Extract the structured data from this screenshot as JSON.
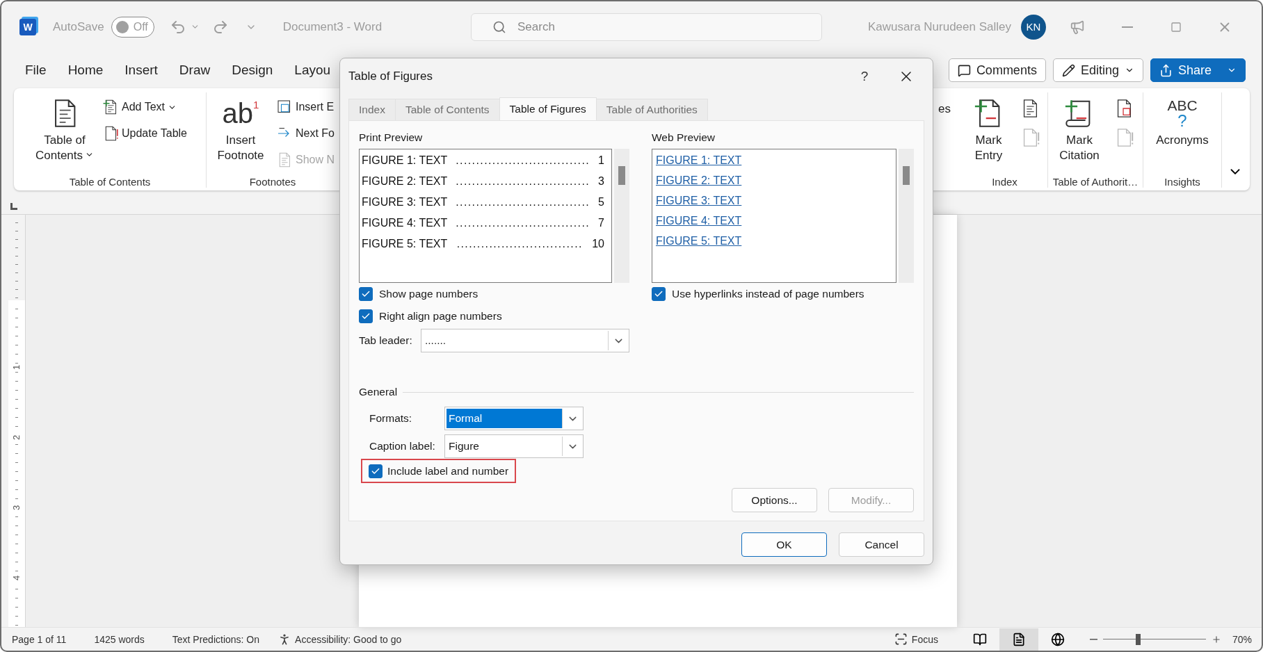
{
  "window": {
    "app_icon": "W",
    "autosave": {
      "label": "AutoSave",
      "on": false,
      "state": "Off"
    },
    "document_title": "Document3 - Word",
    "search": {
      "placeholder": "Search"
    },
    "user": {
      "name": "Kawusara Nurudeen Salley",
      "initials": "KN"
    }
  },
  "menu": {
    "tabs": [
      "File",
      "Home",
      "Insert",
      "Draw",
      "Design",
      "Layou"
    ],
    "actions": [
      {
        "kind": "comments",
        "label": "Comments"
      },
      {
        "kind": "editing",
        "label": "Editing"
      },
      {
        "kind": "share",
        "label": "Share"
      }
    ]
  },
  "ribbon": {
    "left_groups": [
      {
        "label": "Table of Contents",
        "items": [
          {
            "kind": "toc",
            "label": "Table of Contents",
            "dropdown": true
          },
          {
            "kind": "add-text",
            "label": "Add Text",
            "dropdown": true
          },
          {
            "kind": "update-table",
            "label": "Update Table",
            "dropdown": false
          }
        ]
      },
      {
        "label": "Footnotes",
        "items": [
          {
            "kind": "footnote",
            "label": "Insert Footnote",
            "glyph": "ab",
            "mark": "1"
          },
          {
            "kind": "insert-endnote",
            "label": "Insert E",
            "disabled": false
          },
          {
            "kind": "next-footnote",
            "label": "Next Fo",
            "disabled": false
          },
          {
            "kind": "show-notes",
            "label": "Show N",
            "disabled": true
          }
        ]
      }
    ],
    "fragment": "es",
    "right_groups": [
      {
        "label": "Index",
        "items": [
          {
            "kind": "mark-entry",
            "label": "Mark Entry"
          }
        ],
        "side_icons": [
          {
            "kind": "index-doc",
            "disabled": false
          },
          {
            "kind": "update-doc",
            "disabled": true
          }
        ]
      },
      {
        "label": "Table of Authorit…",
        "items": [
          {
            "kind": "mark-citation",
            "label": "Mark Citation"
          }
        ],
        "side_icons": [
          {
            "kind": "authorities-doc",
            "disabled": false
          },
          {
            "kind": "update-doc",
            "disabled": true
          }
        ]
      },
      {
        "label": "Insights",
        "items": [
          {
            "kind": "acronyms",
            "label": "Acronyms",
            "glyph": "ABC",
            "mark": "?"
          }
        ]
      }
    ]
  },
  "vertical_ruler": {
    "numbers": [
      "1",
      "2",
      "3",
      "4"
    ]
  },
  "status_bar": {
    "page": "Page 1 of 11",
    "words": "1425 words",
    "predictions": "Text Predictions: On",
    "accessibility": "Accessibility: Good to go",
    "focus": "Focus",
    "views": [
      {
        "kind": "read",
        "selected": false
      },
      {
        "kind": "print",
        "selected": true
      },
      {
        "kind": "web",
        "selected": false
      }
    ],
    "zoom": {
      "level": 0.34,
      "reading": "70%"
    }
  },
  "dialog": {
    "title": "Table of Figures",
    "help": "?",
    "tabs": [
      {
        "label": "Index",
        "selected": false
      },
      {
        "label": "Table of Contents",
        "selected": false
      },
      {
        "label": "Table of Figures",
        "selected": true
      },
      {
        "label": "Table of Authorities",
        "selected": false
      }
    ],
    "print_preview": {
      "label": "Print Preview",
      "entries": [
        {
          "caption": "FIGURE 1: TEXT",
          "leader": ".................................",
          "page": "1"
        },
        {
          "caption": "FIGURE 2: TEXT",
          "leader": ".................................",
          "page": "3"
        },
        {
          "caption": "FIGURE 3: TEXT",
          "leader": ".................................",
          "page": "5"
        },
        {
          "caption": "FIGURE 4: TEXT",
          "leader": ".................................",
          "page": "7"
        },
        {
          "caption": "FIGURE 5: TEXT",
          "leader": "...............................",
          "page": "10"
        }
      ],
      "options": [
        {
          "label": "Show page numbers",
          "checked": true
        },
        {
          "label": "Right align page numbers",
          "checked": true
        }
      ],
      "tab_leader": {
        "label": "Tab leader:",
        "value": "......."
      }
    },
    "web_preview": {
      "label": "Web Preview",
      "links": [
        "FIGURE 1: TEXT",
        "FIGURE 2: TEXT",
        "FIGURE 3: TEXT",
        "FIGURE 4: TEXT",
        "FIGURE 5: TEXT"
      ],
      "option": {
        "label": "Use hyperlinks instead of page numbers",
        "checked": true
      }
    },
    "general": {
      "label": "General",
      "fields": [
        {
          "label": "Formats:",
          "value": "Formal",
          "focused": true
        },
        {
          "label": "Caption label:",
          "value": "Figure",
          "focused": false
        }
      ],
      "include": {
        "label": "Include label and number",
        "checked": true,
        "highlighted": true
      }
    },
    "buttons": [
      {
        "label": "Options...",
        "disabled": false
      },
      {
        "label": "Modify...",
        "disabled": true
      }
    ],
    "footer_buttons": [
      {
        "label": "OK",
        "default": true
      },
      {
        "label": "Cancel",
        "default": false
      }
    ]
  }
}
